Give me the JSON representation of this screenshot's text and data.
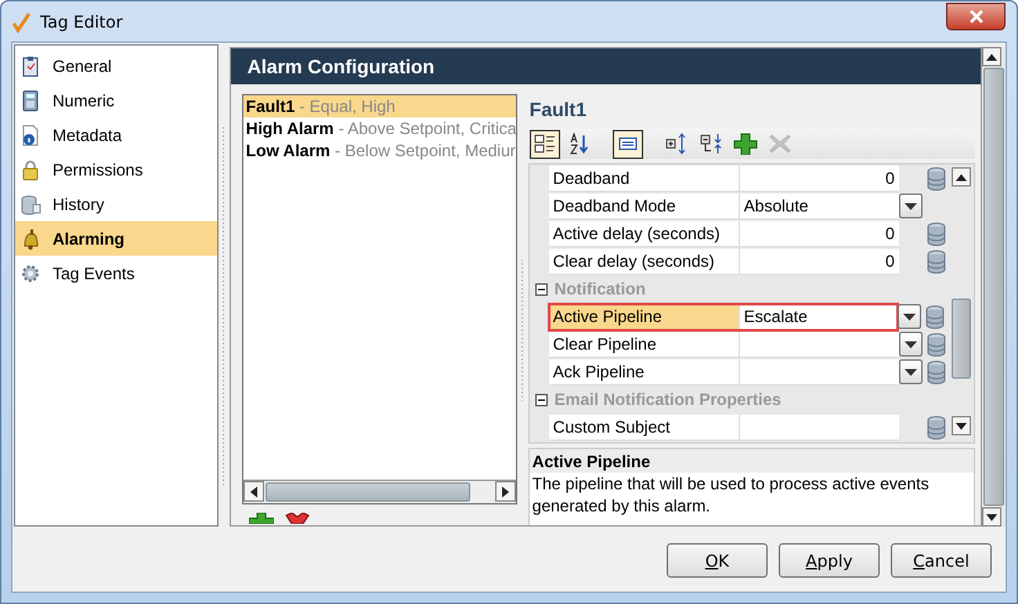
{
  "window": {
    "title": "Tag Editor"
  },
  "sidebar": {
    "items": [
      {
        "label": "General",
        "selected": false
      },
      {
        "label": "Numeric",
        "selected": false
      },
      {
        "label": "Metadata",
        "selected": false
      },
      {
        "label": "Permissions",
        "selected": false
      },
      {
        "label": "History",
        "selected": false
      },
      {
        "label": "Alarming",
        "selected": true
      },
      {
        "label": "Tag Events",
        "selected": false
      }
    ]
  },
  "panel": {
    "title": "Alarm Configuration"
  },
  "alarms": [
    {
      "name": "Fault1",
      "detail": "- Equal, High",
      "selected": true
    },
    {
      "name": "High Alarm",
      "detail": "- Above Setpoint, Critica",
      "selected": false
    },
    {
      "name": "Low Alarm",
      "detail": "- Below Setpoint, Mediur",
      "selected": false
    }
  ],
  "editor": {
    "title": "Fault1"
  },
  "toolbar": [
    {
      "pressed": true,
      "disabled": false
    },
    {
      "pressed": false,
      "disabled": false
    },
    {
      "pressed": true,
      "disabled": false
    },
    {
      "pressed": false,
      "disabled": false
    },
    {
      "pressed": false,
      "disabled": false
    },
    {
      "pressed": false,
      "disabled": false
    },
    {
      "pressed": false,
      "disabled": true
    }
  ],
  "properties": [
    {
      "kind": "number",
      "name": "Deadband",
      "value": "0",
      "dropdown": false,
      "binding": true,
      "selected": false,
      "outlined": false
    },
    {
      "kind": "text",
      "name": "Deadband Mode",
      "value": "Absolute",
      "dropdown": true,
      "binding": false,
      "selected": false,
      "outlined": false
    },
    {
      "kind": "number",
      "name": "Active delay (seconds)",
      "value": "0",
      "dropdown": false,
      "binding": true,
      "selected": false,
      "outlined": false
    },
    {
      "kind": "number",
      "name": "Clear delay (seconds)",
      "value": "0",
      "dropdown": false,
      "binding": true,
      "selected": false,
      "outlined": false
    },
    {
      "kind": "category",
      "name": "Notification",
      "expanded": true
    },
    {
      "kind": "text",
      "name": "Active Pipeline",
      "value": "Escalate",
      "dropdown": true,
      "binding": true,
      "selected": true,
      "outlined": true
    },
    {
      "kind": "text",
      "name": "Clear Pipeline",
      "dropdown": true,
      "binding": true,
      "selected": false,
      "outlined": false
    },
    {
      "kind": "text",
      "name": "Ack Pipeline",
      "dropdown": true,
      "binding": true,
      "selected": false,
      "outlined": false
    },
    {
      "kind": "category",
      "name": "Email Notification Properties",
      "expanded": true
    },
    {
      "kind": "text",
      "name": "Custom Subject",
      "dropdown": false,
      "binding": true,
      "selected": false,
      "outlined": false
    }
  ],
  "description": {
    "title": "Active Pipeline",
    "text": "The pipeline that will be used to process active events generated by this alarm."
  },
  "buttons": [
    {
      "label": "OK"
    },
    {
      "label": "Apply"
    },
    {
      "label": "Cancel"
    }
  ]
}
